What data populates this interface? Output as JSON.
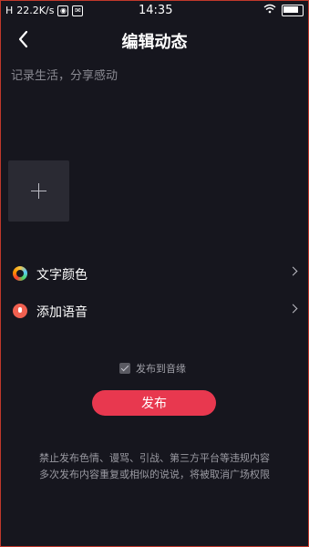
{
  "status_bar": {
    "signal": "H",
    "speed": "22.2K/s",
    "time": "14:35"
  },
  "nav": {
    "title": "编辑动态"
  },
  "caption": {
    "placeholder": "记录生活，分享感动"
  },
  "options": [
    {
      "label": "文字颜色",
      "icon": "color-wheel-icon"
    },
    {
      "label": "添加语音",
      "icon": "microphone-icon"
    }
  ],
  "sync": {
    "label": "发布到音缘",
    "checked": true
  },
  "publish": {
    "label": "发布"
  },
  "notice": {
    "line1": "禁止发布色情、谩骂、引战、第三方平台等违规内容",
    "line2": "多次发布内容重复或相似的说说，将被取消广场权限"
  },
  "colors": {
    "background": "#16161e",
    "accent": "#e8384f"
  }
}
